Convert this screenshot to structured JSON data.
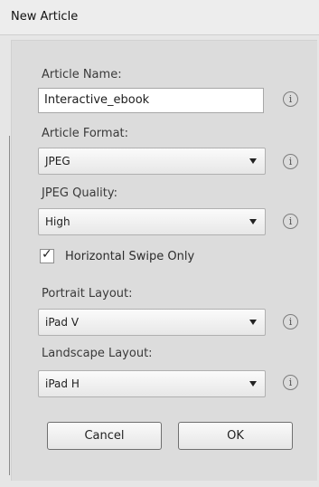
{
  "window": {
    "title": "New Article"
  },
  "fields": {
    "article_name": {
      "label": "Article Name:",
      "value": "Interactive_ebook"
    },
    "article_format": {
      "label": "Article Format:",
      "value": "JPEG"
    },
    "jpeg_quality": {
      "label": "JPEG Quality:",
      "value": "High"
    },
    "horizontal_swipe": {
      "label": "Horizontal Swipe Only",
      "checked": true,
      "mark": "✓"
    },
    "portrait_layout": {
      "label": "Portrait Layout:",
      "value": "iPad V"
    },
    "landscape_layout": {
      "label": "Landscape Layout:",
      "value": "iPad H"
    }
  },
  "info_icon": {
    "glyph": "i",
    "icon": "info-icon"
  },
  "buttons": {
    "cancel": "Cancel",
    "ok": "OK"
  }
}
